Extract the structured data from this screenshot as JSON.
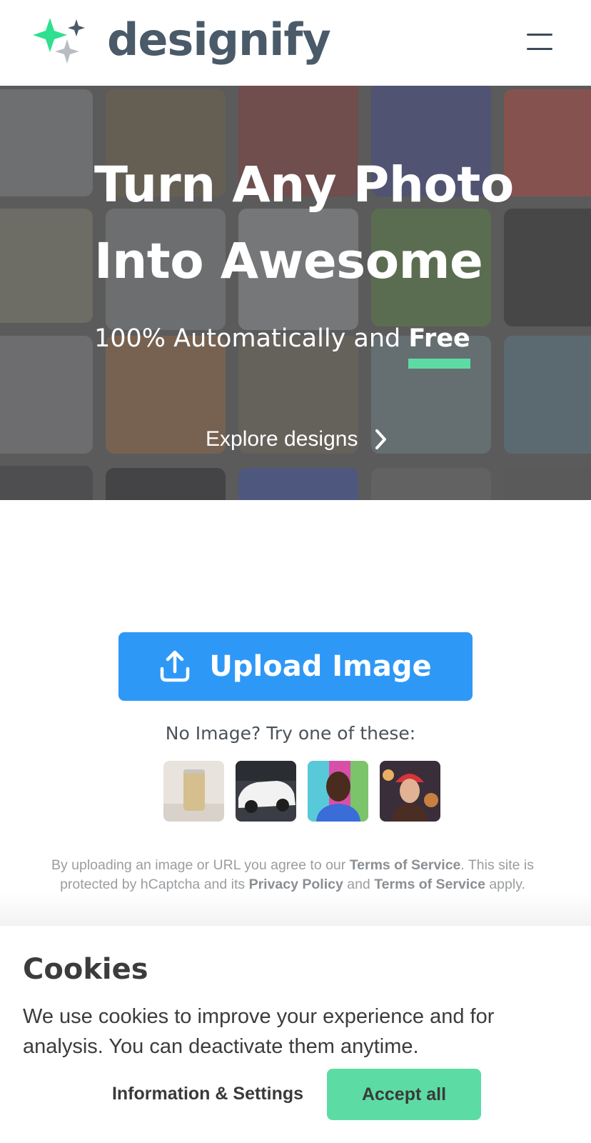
{
  "header": {
    "brand": "designify",
    "menu_icon": "hamburger-menu-icon"
  },
  "hero": {
    "title_line1": "Turn Any Photo",
    "title_line2": "Into Awesome",
    "subtitle_prefix": "100% Automatically and ",
    "subtitle_emphasis": "Free",
    "explore_label": "Explore designs"
  },
  "upload": {
    "button_label": "Upload Image",
    "try_text": "No Image? Try one of these:",
    "samples": [
      "sample-can",
      "sample-car",
      "sample-man",
      "sample-woman"
    ]
  },
  "legal": {
    "t1": "By uploading an image or URL you agree to our ",
    "tos1": "Terms of Service",
    "t2": ". This site is protected by hCaptcha and its ",
    "privacy": "Privacy Policy",
    "t3": " and ",
    "tos2": "Terms of Service",
    "t4": " apply."
  },
  "cookies": {
    "title": "Cookies",
    "text": "We use cookies to improve your experience and for analysis. You can deactivate them anytime.",
    "info_label": "Information & Settings",
    "accept_label": "Accept all"
  },
  "colors": {
    "accent_green": "#5cdca4",
    "upload_blue": "#2e98f7",
    "brand_text": "#4a5a69"
  }
}
